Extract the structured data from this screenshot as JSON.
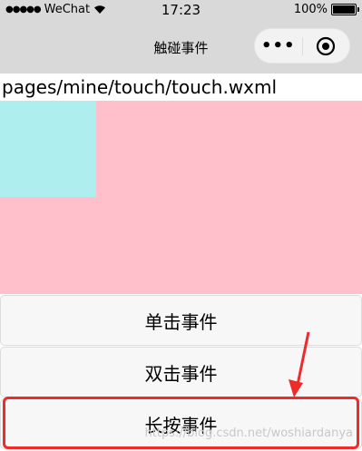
{
  "status_bar": {
    "signal": "●●●●●",
    "carrier": "WeChat",
    "time": "17:23",
    "battery": "100%"
  },
  "nav": {
    "title": "触碰事件",
    "more_icon": "more-dots-icon",
    "close_icon": "target-close-icon"
  },
  "page_path": "pages/mine/touch/touch.wxml",
  "colors": {
    "pink": "#ffc0cb",
    "cyan": "#afeeee",
    "highlight": "#ee2a2a"
  },
  "buttons": [
    {
      "label": "单击事件"
    },
    {
      "label": "双击事件"
    },
    {
      "label": "长按事件"
    }
  ],
  "watermark": "https://blog.csdn.net/woshiardanya"
}
